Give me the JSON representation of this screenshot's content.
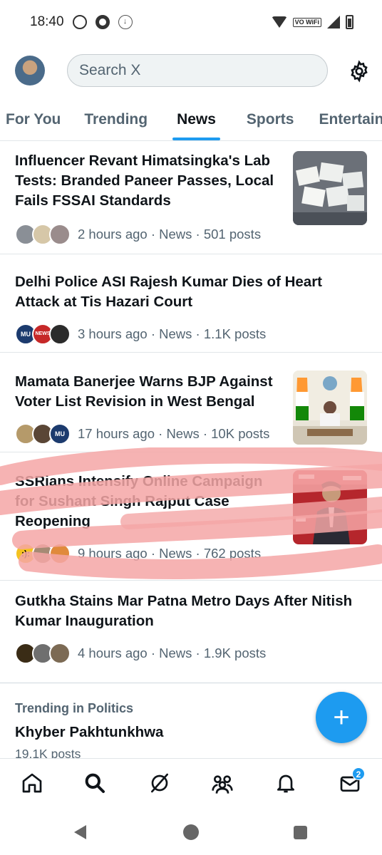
{
  "status_bar": {
    "time": "18:40",
    "vowifi": "VO WiFi"
  },
  "header": {
    "search_placeholder": "Search X"
  },
  "tabs": [
    {
      "label": "For You",
      "active": false
    },
    {
      "label": "Trending",
      "active": false
    },
    {
      "label": "News",
      "active": true
    },
    {
      "label": "Sports",
      "active": false
    },
    {
      "label": "Entertainment",
      "active": false
    }
  ],
  "news": [
    {
      "title": "Influencer Revant Himatsingka's Lab Tests: Branded Paneer Passes, Local Fails FSSAI Standards",
      "meta": "2 hours ago · News · 501 posts",
      "thumb": "paneer-photo"
    },
    {
      "title": "Delhi Police ASI Rajesh Kumar Dies of Heart Attack at Tis Hazari Court",
      "meta": "3 hours ago · News · 1.1K posts",
      "face_labels": [
        "MU",
        "NEWS"
      ]
    },
    {
      "title": "Mamata Banerjee Warns BJP Against Voter List Revision in West Bengal",
      "meta": "17 hours ago · News · 10K posts",
      "thumb": "press-conference-photo",
      "face_labels": [
        "MU"
      ]
    },
    {
      "title": "SSRians Intensify Online Campaign for Sushant Singh Rajput Case Reopening",
      "meta": "9 hours ago · News · 762 posts",
      "thumb": "actor-photo"
    },
    {
      "title": "Gutkha Stains Mar Patna Metro Days After Nitish Kumar Inauguration",
      "meta": "4 hours ago · News · 1.9K posts"
    }
  ],
  "trending": {
    "category": "Trending in Politics",
    "name": "Khyber Pakhtunkhwa",
    "count": "19.1K posts"
  },
  "fab": {
    "label": "+"
  },
  "bottom_nav": {
    "items": [
      "home-icon",
      "search-icon",
      "grok-icon",
      "communities-icon",
      "notifications-icon",
      "messages-icon"
    ],
    "messages_badge": "2"
  },
  "colors": {
    "accent": "#1d9bf0",
    "text": "#0f1419",
    "secondary": "#536471",
    "highlight": "#f4a6a6"
  }
}
